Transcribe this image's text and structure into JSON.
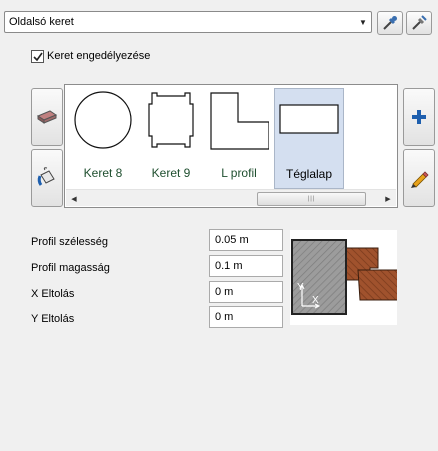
{
  "dropdown": {
    "value": "Oldalsó keret"
  },
  "checkbox": {
    "label": "Keret engedélyezése",
    "checked": true
  },
  "gallery": {
    "items": [
      {
        "label": "Keret 8",
        "shape": "circle",
        "selected": false
      },
      {
        "label": "Keret 9",
        "shape": "notched-rectangle",
        "selected": false
      },
      {
        "label": "L profil",
        "shape": "l-shape",
        "selected": false
      },
      {
        "label": "Téglalap",
        "shape": "rectangle",
        "selected": true
      }
    ],
    "scroll_fraction": 0.4
  },
  "fields": [
    {
      "label": "Profil szélesség",
      "value": "0.05 m"
    },
    {
      "label": "Profil magasság",
      "value": "0.1 m"
    },
    {
      "label": "X Eltolás",
      "value": "0 m"
    },
    {
      "label": "Y Eltolás",
      "value": "0 m"
    }
  ],
  "preview": {
    "axis_x": "X",
    "axis_y": "Y"
  },
  "icons": {
    "eyedropper": "eyedropper-icon",
    "pick": "pick-material-icon",
    "material": "material-icon",
    "paint": "paint-bucket-icon",
    "add": "plus-icon",
    "edit": "pencil-icon"
  },
  "colors": {
    "accent_plus": "#1e5fae",
    "wood": "#a0522d",
    "gray_profile": "#9a9a9a"
  }
}
